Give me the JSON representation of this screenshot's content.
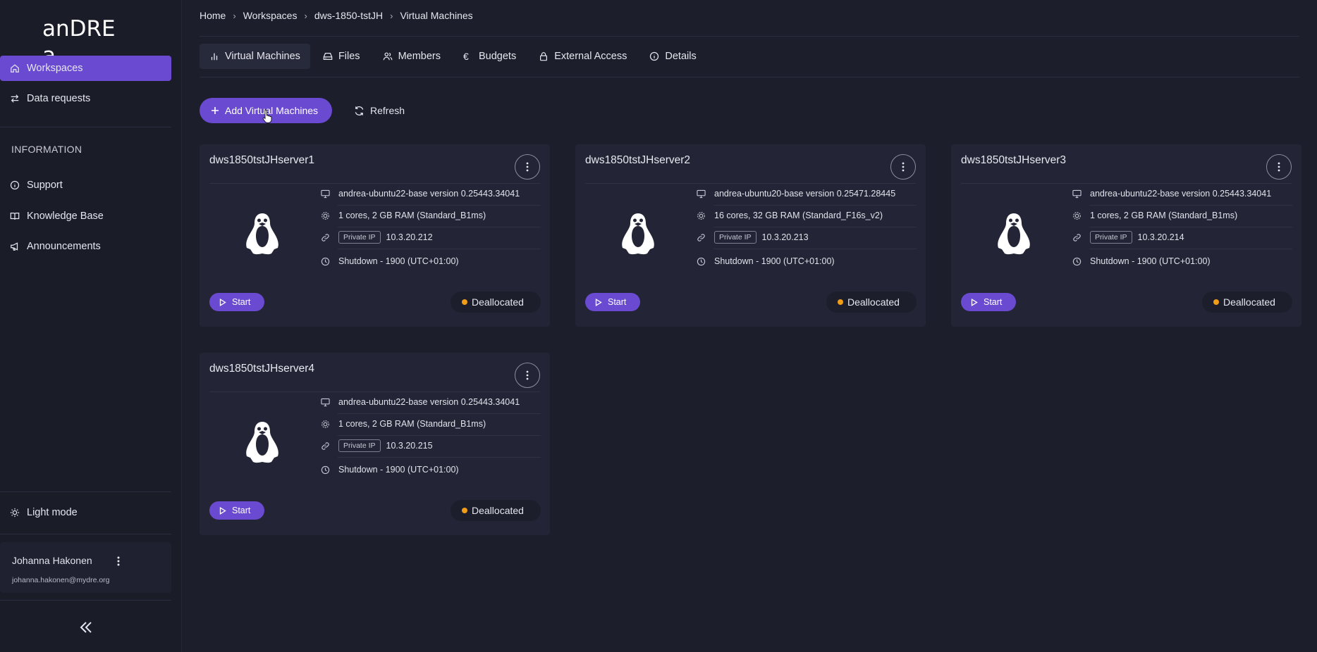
{
  "app": {
    "logo_text": "anDRE a"
  },
  "sidebar": {
    "nav": [
      {
        "label": "Workspaces",
        "icon": "home-icon",
        "active": true
      },
      {
        "label": "Data requests",
        "icon": "arrows-exchange-icon"
      }
    ],
    "section_label": "INFORMATION",
    "info_items": [
      {
        "label": "Support",
        "icon": "info-icon"
      },
      {
        "label": "Knowledge Base",
        "icon": "book-icon"
      },
      {
        "label": "Announcements",
        "icon": "megaphone-icon"
      }
    ],
    "light_mode_label": "Light mode",
    "user": {
      "name": "Johanna Hakonen",
      "email": "johanna.hakonen@mydre.org"
    }
  },
  "breadcrumb": [
    "Home",
    "Workspaces",
    "dws-1850-tstJH",
    "Virtual Machines"
  ],
  "tabs": [
    {
      "label": "Virtual Machines",
      "icon": "bar-chart-icon",
      "active": true
    },
    {
      "label": "Files",
      "icon": "drive-icon"
    },
    {
      "label": "Members",
      "icon": "users-icon"
    },
    {
      "label": "Budgets",
      "icon": "euro-icon"
    },
    {
      "label": "External Access",
      "icon": "lock-icon"
    },
    {
      "label": "Details",
      "icon": "info-icon"
    }
  ],
  "actions": {
    "add_label": "Add Virtual Machines",
    "refresh_label": "Refresh"
  },
  "vms": [
    {
      "name": "dws1850tstJHserver1",
      "image": "andrea-ubuntu22-base version 0.25443.34041",
      "size": "1 cores, 2 GB RAM (Standard_B1ms)",
      "ip_label": "Private IP",
      "ip": "10.3.20.212",
      "shutdown": "Shutdown -  1900  (UTC+01:00)",
      "start_label": "Start",
      "status": "Deallocated"
    },
    {
      "name": "dws1850tstJHserver2",
      "image": "andrea-ubuntu20-base version 0.25471.28445",
      "size": "16 cores, 32 GB RAM (Standard_F16s_v2)",
      "ip_label": "Private IP",
      "ip": "10.3.20.213",
      "shutdown": "Shutdown -  1900  (UTC+01:00)",
      "start_label": "Start",
      "status": "Deallocated"
    },
    {
      "name": "dws1850tstJHserver3",
      "image": "andrea-ubuntu22-base version 0.25443.34041",
      "size": "1 cores, 2 GB RAM (Standard_B1ms)",
      "ip_label": "Private IP",
      "ip": "10.3.20.214",
      "shutdown": "Shutdown -  1900  (UTC+01:00)",
      "start_label": "Start",
      "status": "Deallocated"
    },
    {
      "name": "dws1850tstJHserver4",
      "image": "andrea-ubuntu22-base version 0.25443.34041",
      "size": "1 cores, 2 GB RAM (Standard_B1ms)",
      "ip_label": "Private IP",
      "ip": "10.3.20.215",
      "shutdown": "Shutdown -  1900  (UTC+01:00)",
      "start_label": "Start",
      "status": "Deallocated"
    }
  ],
  "colors": {
    "accent": "#6a4ad1",
    "status_deallocated": "#f29d17",
    "background": "#1c1e2b"
  }
}
